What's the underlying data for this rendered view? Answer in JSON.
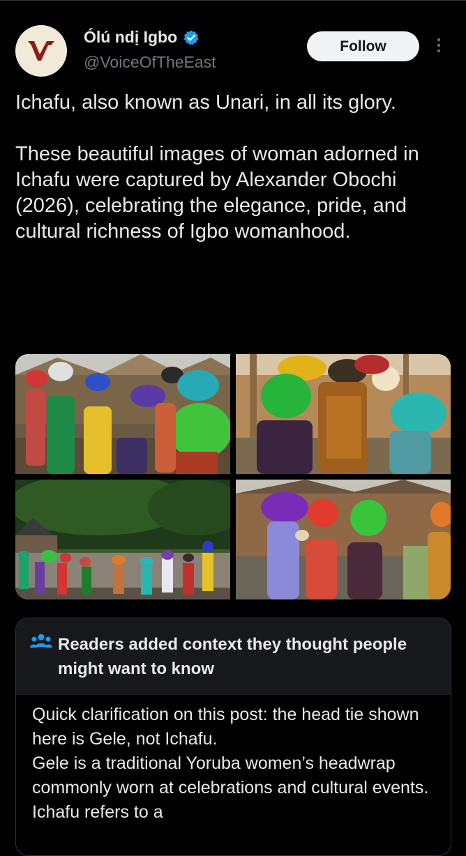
{
  "post": {
    "author": {
      "display_name": "Ólú ndị Igbo",
      "handle": "@VoiceOfTheEast",
      "avatar_icon": "voice-of-the-east-logo",
      "verified": true
    },
    "follow_label": "Follow",
    "text": {
      "paragraph_1": "Ichafu, also known as Unari, in all its glory.",
      "paragraph_2": "These beautiful images of woman adorned in Ichafu were captured by Alexander Obochi (2026), celebrating the elegance, pride, and cultural richness of Igbo womanhood."
    },
    "media": [
      {
        "icon": "photo-women-in-colorful-headwraps-village"
      },
      {
        "icon": "photo-women-seated-in-headwraps"
      },
      {
        "icon": "photo-procession-under-tree"
      },
      {
        "icon": "photo-women-walking-in-headwraps"
      }
    ]
  },
  "community_note": {
    "icon": "people-icon",
    "title": "Readers added context they thought people might want to know",
    "body_line_1": "Quick clarification on this post: the head tie shown here is Gele, not Ichafu.",
    "body_line_2": "Gele is a traditional Yoruba women’s headwrap commonly worn at celebrations and cultural events. Ichafu refers to a"
  },
  "colors": {
    "background": "#000000",
    "text": "#e7e9ea",
    "muted": "#71767b",
    "verified": "#1d9bf0",
    "avatar_bg": "#f2ead9",
    "avatar_mark": "#8b1d17",
    "note_header_bg": "#16181c"
  }
}
